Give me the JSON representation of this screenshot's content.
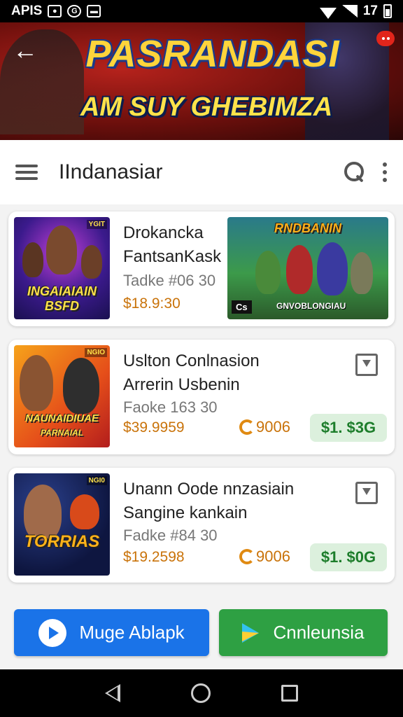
{
  "status_bar": {
    "left_text": "APIS",
    "right_text": "17"
  },
  "banner": {
    "title": "PASRANDASI",
    "subtitle": "AM SUY GHEBIMZA"
  },
  "appbar": {
    "title": "IIndanasiar"
  },
  "cards": [
    {
      "title_line1": "Drokancka",
      "title_line2": "FantsanKask",
      "subtitle": "Tadke #06 30",
      "price": "$18.9:30",
      "thumb_text": "INGAIAIAIN BSFD",
      "thumb_tag": "YGIT",
      "promo_title": "RNDBANIN",
      "promo_label": "GNVOBLONGIAU",
      "promo_badge": "Cs"
    },
    {
      "title_line1": "Uslton Conlnasion",
      "title_line2": "Arrerin Usbenin",
      "subtitle": "Faoke 163 30",
      "price": "$39.9959",
      "coins": "9006",
      "action_price": "$1. $3G",
      "thumb_text": "NAUNAIDIUAE",
      "thumb_sub": "PARNAIAL",
      "thumb_tag": "NGIO"
    },
    {
      "title_line1": "Unann Oode nnzasiain",
      "title_line2": "Sangine kankain",
      "subtitle": "Fadke #84 30",
      "price": "$19.2598",
      "coins": "9006",
      "action_price": "$1. $0G",
      "thumb_text": "TORRIAS",
      "thumb_tag": "NGI0"
    }
  ],
  "buttons": {
    "primary": "Muge Ablapk",
    "secondary": "Cnnleunsia"
  },
  "icons": [
    "back-arrow-icon",
    "menu-icon",
    "search-icon",
    "more-vert-icon",
    "bookmark-icon",
    "coin-icon",
    "play-circle-icon",
    "google-play-icon",
    "nav-back-icon",
    "nav-home-icon",
    "nav-recents-icon"
  ],
  "colors": {
    "accent_blue": "#1a73e8",
    "accent_green": "#2ea043",
    "price_orange": "#c9730a",
    "pill_green_bg": "#dcf0dd"
  }
}
